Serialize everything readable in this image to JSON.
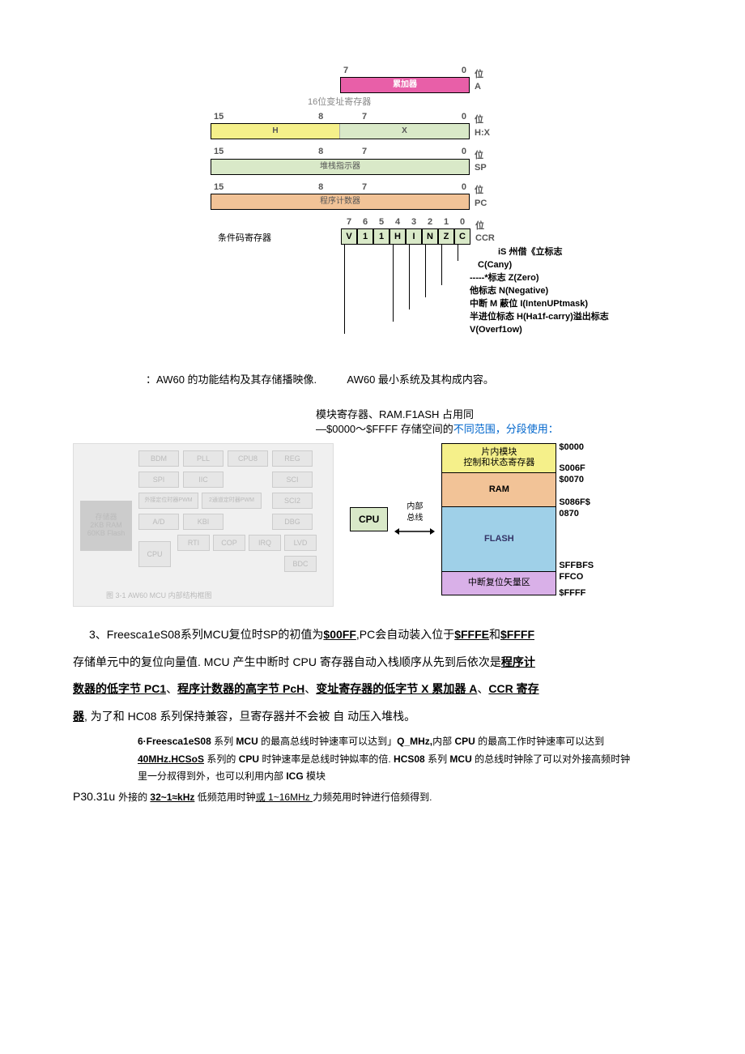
{
  "reg": {
    "bit7": "7",
    "bit0": "0",
    "wei": "位",
    "acc_label": "累加器",
    "A": "A",
    "idx16": "16位变址寄存器",
    "H": "H",
    "X": "X",
    "HX": "H:X",
    "bit15": "15",
    "bit8": "8",
    "sp": "堆栈指示器",
    "SP": "SP",
    "pc": "程序计数器",
    "PC": "PC",
    "ccr_bits": [
      "7",
      "6",
      "5",
      "4",
      "3",
      "2",
      "1",
      "0"
    ],
    "ccr_flags": [
      "V",
      "1",
      "1",
      "H",
      "I",
      "N",
      "Z",
      "C"
    ],
    "ccr_label": "条件码寄存器",
    "CCR": "CCR",
    "flag_carry": "iS 州借《立标志",
    "flag_c": "C(Cany)",
    "flag_zero": "-----*标志 Z(Zero)",
    "flag_neg": "他标志 N(Negative)",
    "flag_int": "中断 M 蔽位 I(IntenUPtmask)",
    "flag_half": "半进位标态 H(Ha1f-carry)溢出标志",
    "flag_v": "V(Overf1ow)"
  },
  "middle": {
    "line1a": "：AW60 的功能结构及其存储播映像.",
    "line1b": "AW60 最小系统及其构成内容。",
    "line2": "模块寄存器、RAM.F1ASH 占用同",
    "line3a": "—$0000～$FFFF 存储空间的",
    "line3b": "不同范围，分段使用："
  },
  "mem": {
    "seg1": "片内模块\n控制和状态寄存器",
    "seg2": "RAM",
    "seg3": "FLASH",
    "seg4": "中断复位矢量区",
    "a0000": "$0000",
    "a006f": "S006F",
    "a0070": "$0070",
    "a086f": "S086F$",
    "a0870": "0870",
    "affbf": "SFFBFS",
    "affc0": "FFCO",
    "affff": "$FFFF",
    "cpu": "CPU",
    "bus": "内部\n总线"
  },
  "block": {
    "bdm": "BDM",
    "pll": "PLL",
    "cpu8": "CPU8",
    "reg": "REG",
    "spi": "SPI",
    "iic": "IIC",
    "sci": "SCI",
    "pwm1": "外接定位时器PWM",
    "pwm2": "2通道定时器PWM",
    "sci2": "SCI2",
    "ad": "A/D",
    "kbi": "KBI",
    "dbg": "DBG",
    "cpu": "CPU",
    "rti": "RTI",
    "cop": "COP",
    "irq": "IRQ",
    "lvd": "LVD",
    "bdc": "BDC",
    "leftblock": "存储器\n2KB RAM\n60KB Flash",
    "caption": "图 3-1  AW60 MCU 内部结构框图"
  },
  "para": {
    "p3a": "3、Freesca1eS08系列MCU复位时SP的初值为",
    "p3b": "$00FF",
    "p3c": ",PC会自动装入位于",
    "p3d": "$FFFE",
    "p3e": "和",
    "p3f": "$FFFF",
    "p4a": "存储单元中的复位向量值. MCU 产生中断时 CPU 寄存器自动入栈顺序从先到后依次是",
    "p4b": "程序计",
    "p5a": "数器的低字节 PC1",
    "p5b": "、",
    "p5c": "程序计数器的高字节 PcH",
    "p5d": "、",
    "p5e": "变址寄存器的低字节 X 累加器 A",
    "p5f": "、",
    "p5g": "CCR 寄存",
    "p6a": "器",
    "p6b": ", 为了和 HC08 系列保持兼容，旦寄存器并不会被  自         动压入堆栈。",
    "s1a": "6·Freesca1eS08",
    "s1b": " 系列 ",
    "s1c": "MCU",
    "s1d": " 的最高总线时钟速率可以达到」",
    "s1e": "Q_MHz,",
    "s1f": "内部 ",
    "s1g": "CPU",
    "s1h": " 的最高工作时钟速率可以达到",
    "s2a": "40MHz.HCSoS",
    "s2b": " 系列的 ",
    "s2c": "CPU",
    "s2d": " 时钟速率是总线时钟姒率的倍. ",
    "s2e": "HCS08",
    "s2f": " 系列 ",
    "s2g": "MCU",
    "s2h": " 的总线时钟除了可以对外接高频时钟",
    "s3": "里一分叔得到外，也可以利用内部 ",
    "s3b": "ICG",
    "s3c": " 模块",
    "p7a": "P30.31u ",
    "p7b": "外接的 ",
    "p7c": "32~1≈kHz",
    "p7d": " 低频范用时钟",
    "p7e": "或 1~16MHz ",
    "p7f": "力频苑用时钟进行倍频得到."
  }
}
